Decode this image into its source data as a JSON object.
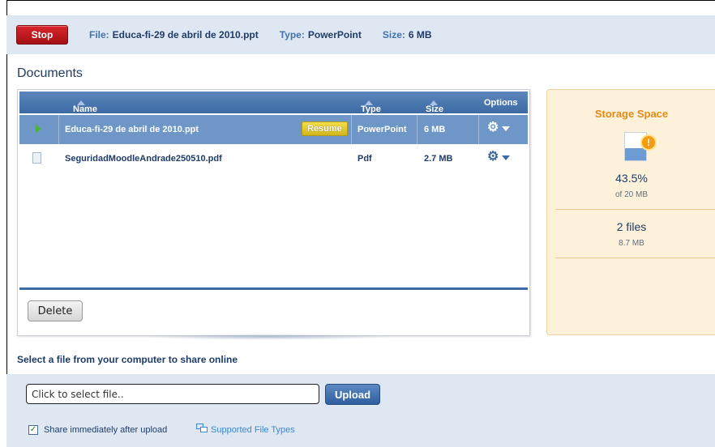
{
  "topbar": {
    "stop_label": "Stop",
    "file_label": "File:",
    "file_value": "Educa-fi-29 de abril de 2010.ppt",
    "type_label": "Type:",
    "type_value": "PowerPoint",
    "size_label": "Size:",
    "size_value": "6 MB"
  },
  "documents": {
    "title": "Documents",
    "columns": [
      "Name",
      "Type",
      "Size",
      "Options"
    ],
    "rows": [
      {
        "name": "Educa-fi-29 de abril de 2010.ppt",
        "type": "PowerPoint",
        "size": "6 MB",
        "action": "Resume",
        "selected": true,
        "icon": "play-icon"
      },
      {
        "name": "SeguridadMoodleAndrade250510.pdf",
        "type": "Pdf",
        "size": "2.7 MB",
        "selected": false,
        "icon": "file-icon"
      }
    ],
    "delete_label": "Delete"
  },
  "storage": {
    "title": "Storage Space",
    "percent": "43.5%",
    "percent_sub": "of 20 MB",
    "usage_fraction": 0.435,
    "files": "2 files",
    "files_sub": "8.7 MB"
  },
  "upload": {
    "title": "Select a file from your computer to share online",
    "input_placeholder": "Click to select file..",
    "upload_label": "Upload",
    "share_checked": true,
    "share_label": "Share immediately after upload",
    "types_link": "Supported File Types"
  },
  "colors": {
    "accent": "#3e6aa4",
    "stop": "#c0181d",
    "storage_title": "#e08b1a",
    "storage_bg": "#fdf1d9",
    "resume": "#e0c62b"
  }
}
